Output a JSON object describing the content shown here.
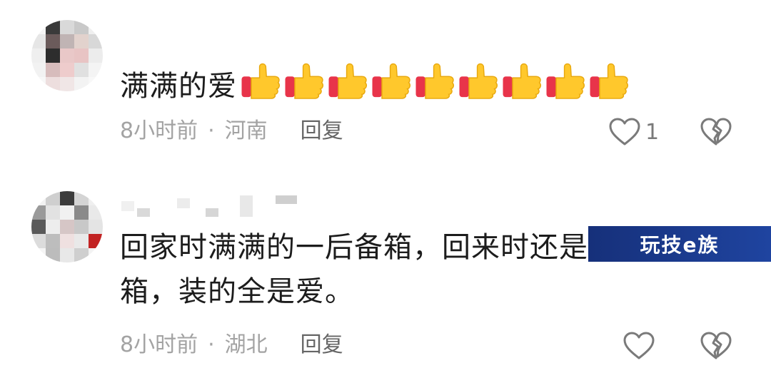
{
  "comments": [
    {
      "text": "满满的爱",
      "emoji": "thumbs-up",
      "emoji_count": 9,
      "time": "8小时前",
      "separator": "·",
      "location": "河南",
      "reply_label": "回复",
      "like_count": "1"
    },
    {
      "text_line1": "回家时满满的一后备箱，回来时还是",
      "text_line2": "箱，装的全是爱。",
      "time": "8小时前",
      "separator": "·",
      "location": "湖北",
      "reply_label": "回复",
      "like_count": ""
    }
  ],
  "watermark": "玩技e族",
  "colors": {
    "text": "#1c1c1c",
    "meta": "#a3a3a3",
    "reply": "#666666",
    "watermark_bg": "#1a3a8f"
  },
  "icons": [
    "heart-outline-icon",
    "broken-heart-icon",
    "thumbs-up-emoji"
  ]
}
